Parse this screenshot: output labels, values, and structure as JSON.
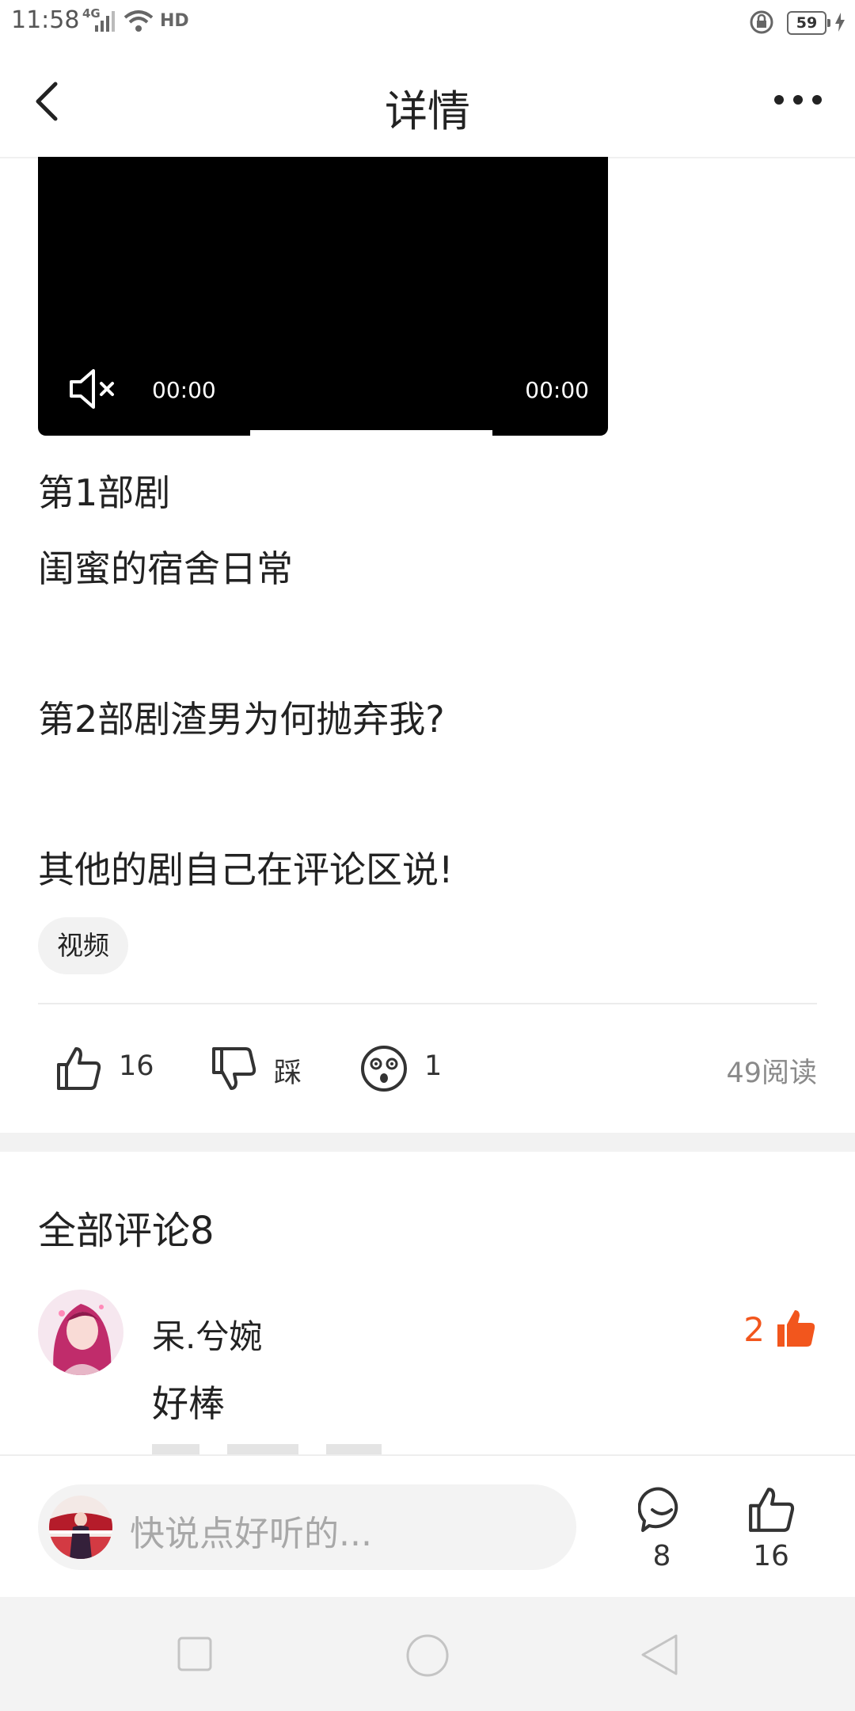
{
  "status_bar": {
    "time": "11:58",
    "network": "4G",
    "hd": "HD",
    "battery": "59"
  },
  "header": {
    "title": "详情"
  },
  "video": {
    "current_time": "00:00",
    "duration": "00:00"
  },
  "article": {
    "paragraphs": [
      "第1部剧",
      "闺蜜的宿舍日常",
      "第2部剧渣男为何抛弃我?",
      "其他的剧自己在评论区说!"
    ],
    "tag": "视频"
  },
  "actions": {
    "likes": "16",
    "dislike_label": "踩",
    "emoji_count": "1",
    "reads": "49阅读"
  },
  "comments": {
    "title": "全部评论8",
    "items": [
      {
        "author": "呆.兮婉",
        "text": "好棒",
        "likes": "2"
      }
    ]
  },
  "bottom_bar": {
    "placeholder": "快说点好听的...",
    "comment_count": "8",
    "like_count": "16"
  },
  "colors": {
    "accent": "#f2561d"
  }
}
